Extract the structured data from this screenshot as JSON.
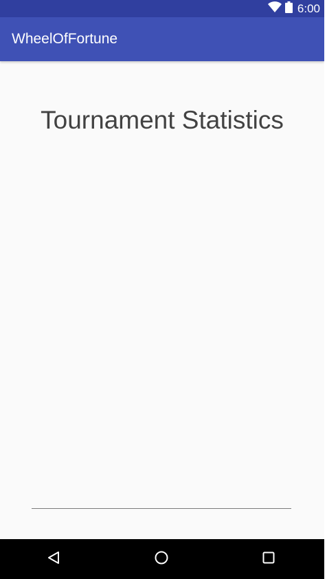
{
  "status_bar": {
    "time": "6:00",
    "icons": [
      "wifi-icon",
      "battery-icon"
    ],
    "color": "#303f9f"
  },
  "app_bar": {
    "title": "WheelOfFortune",
    "color": "#3f51b5"
  },
  "main": {
    "title": "Tournament Statistics"
  },
  "nav_bar": {
    "buttons": [
      "back-icon",
      "home-icon",
      "recents-icon"
    ]
  }
}
